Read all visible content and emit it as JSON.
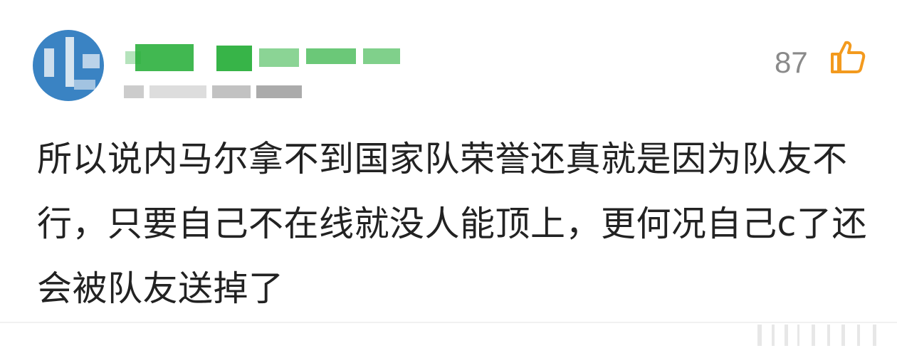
{
  "comment": {
    "like_count": "87",
    "like_icon": "thumbs-up-icon",
    "text": "所以说内马尔拿不到国家队荣誉还真就是因为队友不行，只要自己不在线就没人能顶上，更何况自己c了还会被队友送掉了"
  },
  "colors": {
    "avatar_bg": "#3a83c3",
    "username_green": "#2cb03e",
    "like_orange": "#f39a1e",
    "like_count_gray": "#8a8a8a",
    "text": "#222222"
  }
}
